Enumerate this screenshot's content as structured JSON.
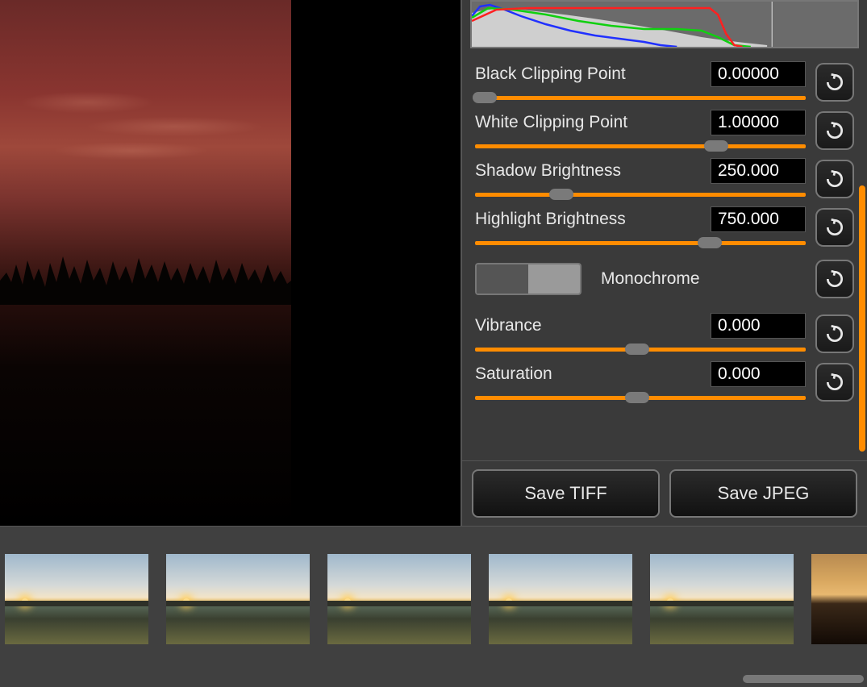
{
  "sliders": {
    "black_clip": {
      "label": "Black Clipping Point",
      "value": "0.00000",
      "pos": 3
    },
    "white_clip": {
      "label": "White Clipping Point",
      "value": "1.00000",
      "pos": 73
    },
    "shadow": {
      "label": "Shadow Brightness",
      "value": "250.000",
      "pos": 26
    },
    "highlight": {
      "label": "Highlight Brightness",
      "value": "750.000",
      "pos": 71
    },
    "vibrance": {
      "label": "Vibrance",
      "value": "0.000",
      "pos": 49
    },
    "saturation": {
      "label": "Saturation",
      "value": "0.000",
      "pos": 49
    }
  },
  "toggle": {
    "label": "Monochrome",
    "state": "off"
  },
  "buttons": {
    "save_tiff": "Save TIFF",
    "save_jpeg": "Save JPEG"
  },
  "icons": {
    "reset": "reset-icon"
  },
  "filmstrip": {
    "count": 6
  }
}
